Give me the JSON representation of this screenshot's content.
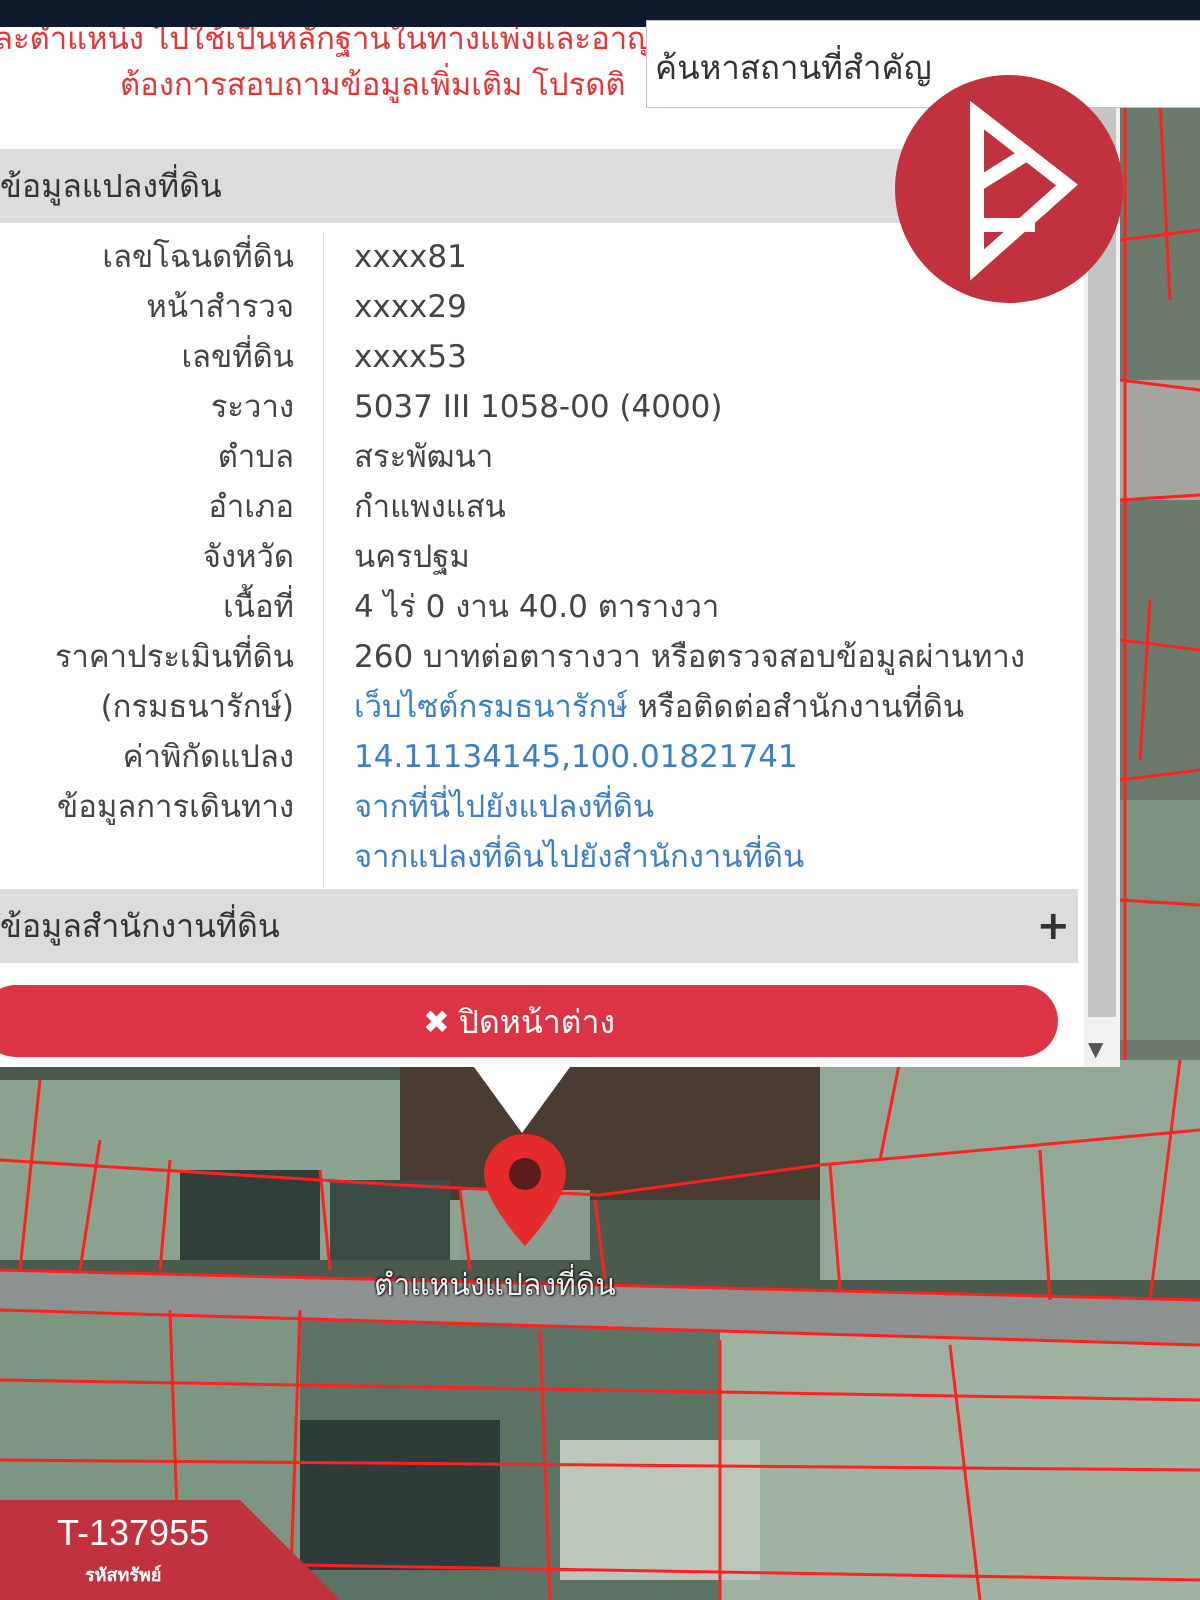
{
  "notice": {
    "line1": "ละตำแหน่ง ไปใช้เป็นหลักฐานในทางแพ่งและอาญาได้ ทั้งนี้ หากมีข้อสงสัยหรือ",
    "line2": "ต้องการสอบถามข้อมูลเพิ่มเติม โปรดติ"
  },
  "search": {
    "value": "ค้นหาสถานที่สำคัญ",
    "placeholder": "ค้นหาสถานที่สำคัญ"
  },
  "land_section": {
    "title": "ข้อมูลแปลงที่ดิน",
    "rows": [
      {
        "label": "เลขโฉนดที่ดิน",
        "value": "xxxx81"
      },
      {
        "label": "หน้าสำรวจ",
        "value": "xxxx29"
      },
      {
        "label": "เลขที่ดิน",
        "value": "xxxx53"
      },
      {
        "label": "ระวาง",
        "value": "5037 III 1058-00 (4000)"
      },
      {
        "label": "ตำบล",
        "value": "สระพัฒนา"
      },
      {
        "label": "อำเภอ",
        "value": "กำแพงแสน"
      },
      {
        "label": "จังหวัด",
        "value": "นครปฐม"
      },
      {
        "label": "เนื้อที่",
        "value": "4 ไร่ 0 งาน 40.0 ตารางวา"
      }
    ],
    "appraisal": {
      "label1": "ราคาประเมินที่ดิน",
      "label2": "(กรมธนารักษ์)",
      "value1": "260 บาทต่อตารางวา หรือตรวจสอบข้อมูลผ่านทาง",
      "link": "เว็บไซต์กรมธนารักษ์",
      "value2": " หรือติดต่อสำนักงานที่ดิน"
    },
    "coord": {
      "label": "ค่าพิกัดแปลง",
      "value": "14.11134145,100.01821741"
    },
    "travel": {
      "label": "ข้อมูลการเดินทาง",
      "link1": "จากที่นี่ไปยังแปลงที่ดิน",
      "link2": "จากแปลงที่ดินไปยังสำนักงานที่ดิน"
    }
  },
  "office_section": {
    "title": "ข้อมูลสำนักงานที่ดิน",
    "expand_symbol": "+"
  },
  "close_button": {
    "icon": "✖",
    "label": "ปิดหน้าต่าง"
  },
  "marker": {
    "label": "ตำแหน่งแปลงที่ดิน"
  },
  "asset": {
    "code": "T-137955",
    "caption": "รหัสทรัพย์"
  },
  "colors": {
    "brand": "#c1313e",
    "close_button": "#dd3445",
    "link": "#3c7fc8",
    "parcel_lines": "#ff2020"
  },
  "icons": {
    "logo": "brand-logo-icon",
    "marker": "map-pin-icon",
    "close": "close-icon"
  }
}
